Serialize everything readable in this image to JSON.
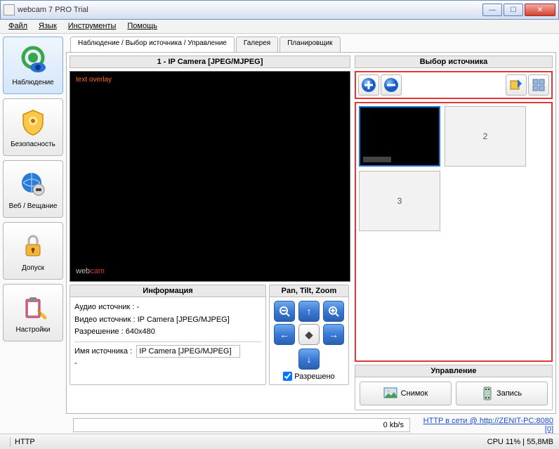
{
  "window": {
    "title": "webcam 7 PRO Trial"
  },
  "menu": {
    "file": "Файл",
    "lang": "Язык",
    "tools": "Инструменты",
    "help": "Помощь"
  },
  "sidebar": [
    {
      "label": "Наблюдение",
      "active": true
    },
    {
      "label": "Безопасность"
    },
    {
      "label": "Веб / Вещание"
    },
    {
      "label": "Допуск"
    },
    {
      "label": "Настройки"
    }
  ],
  "tabs": [
    {
      "label": "Наблюдение / Выбор источника / Управление",
      "active": true
    },
    {
      "label": "Галерея"
    },
    {
      "label": "Планировщик"
    }
  ],
  "preview": {
    "title": "1 - IP Camera [JPEG/MJPEG]",
    "overlay": "text overlay",
    "watermark_a": "web",
    "watermark_b": "cam"
  },
  "info": {
    "header": "Информация",
    "audio_lbl": "Аудио источник :",
    "audio_val": "-",
    "video_lbl": "Видео источник :",
    "video_val": "IP Camera [JPEG/MJPEG]",
    "res_lbl": "Разрешение :",
    "res_val": "640x480",
    "name_lbl": "Имя источника :",
    "name_val": "IP Camera [JPEG/MJPEG]",
    "dash": "-"
  },
  "ptz": {
    "header": "Pan, Tilt, Zoom",
    "allowed": "Разрешено"
  },
  "source": {
    "header": "Выбор источника",
    "slot2": "2",
    "slot3": "3"
  },
  "mgmt": {
    "header": "Управление",
    "snapshot": "Снимок",
    "record": "Запись"
  },
  "kbs": {
    "rate": "0 kb/s",
    "link": "HTTP в сети @ http://ZENIT-PC:8080 [0]"
  },
  "status": {
    "proto": "HTTP",
    "cpu": "CPU 11% | 55,8MB"
  }
}
